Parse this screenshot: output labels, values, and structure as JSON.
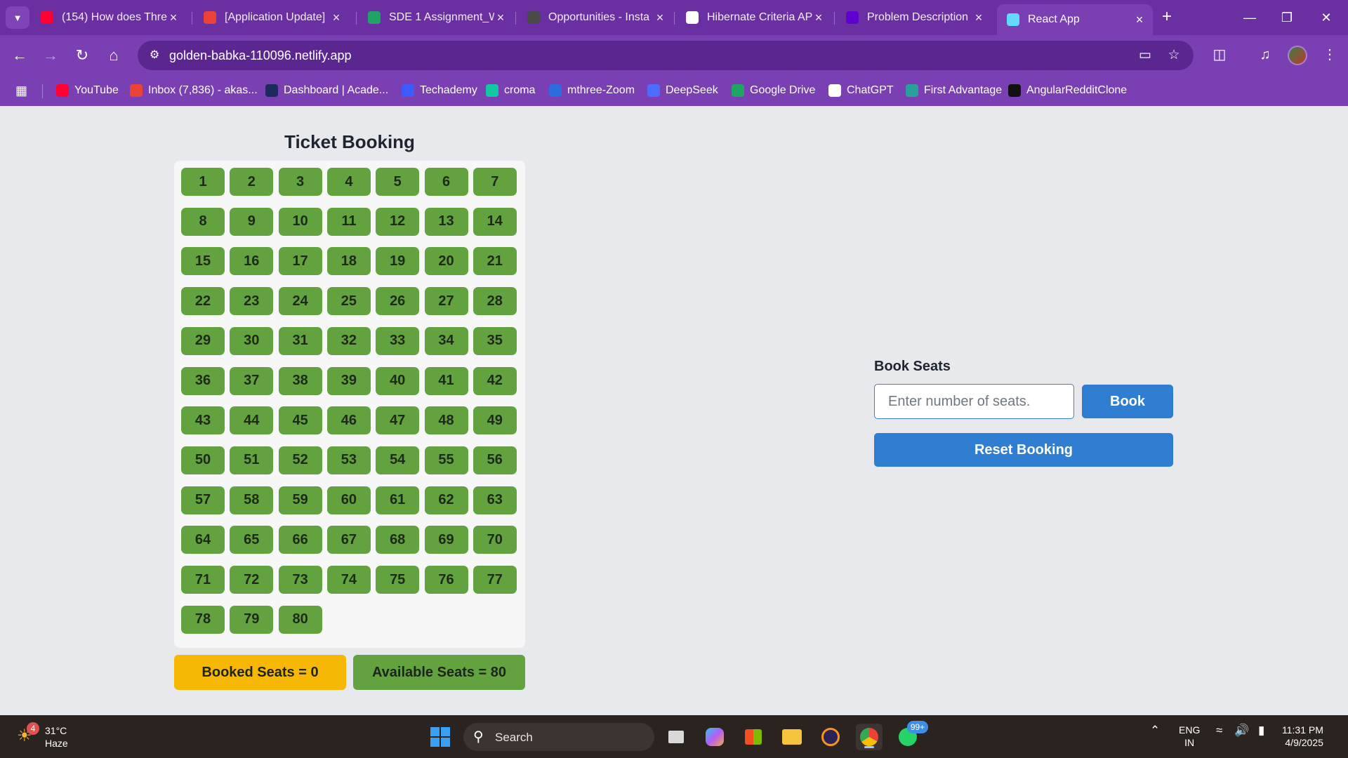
{
  "browser": {
    "tabs": [
      {
        "title": "(154) How does Thre",
        "icon": "youtube-icon",
        "color": "#ff0033",
        "active": false
      },
      {
        "title": "[Application Update]",
        "icon": "gmail-icon",
        "color": "#ea4335",
        "active": false
      },
      {
        "title": "SDE 1 Assignment_W",
        "icon": "google-drive-icon",
        "color": "#1fa463",
        "active": false
      },
      {
        "title": "Opportunities - Insta",
        "icon": "instahyre-icon",
        "color": "#4a4a4a",
        "active": false
      },
      {
        "title": "Hibernate Criteria AP",
        "icon": "chatgpt-icon",
        "color": "#ffffff",
        "active": false
      },
      {
        "title": "Problem Description",
        "icon": "yahoo-icon",
        "color": "#6001d2",
        "active": false
      },
      {
        "title": "React App",
        "icon": "react-icon",
        "color": "#61dafb",
        "active": true
      }
    ],
    "url": "golden-babka-110096.netlify.app",
    "bookmarks": [
      {
        "label": "YouTube",
        "icon": "youtube-icon",
        "color": "#ff0033"
      },
      {
        "label": "Inbox (7,836) - akas...",
        "icon": "gmail-icon",
        "color": "#ea4335"
      },
      {
        "label": "Dashboard | Acade...",
        "icon": "dashboard-icon",
        "color": "#1a2b5c"
      },
      {
        "label": "Techademy",
        "icon": "techademy-icon",
        "color": "#3d5afe"
      },
      {
        "label": "croma",
        "icon": "croma-icon",
        "color": "#12c7a3"
      },
      {
        "label": "mthree-Zoom",
        "icon": "zoom-icon",
        "color": "#2d6cdf"
      },
      {
        "label": "DeepSeek",
        "icon": "deepseek-icon",
        "color": "#4d6bfe"
      },
      {
        "label": "Google Drive",
        "icon": "google-drive-icon",
        "color": "#1fa463"
      },
      {
        "label": "ChatGPT",
        "icon": "chatgpt-icon",
        "color": "#ffffff"
      },
      {
        "label": "First Advantage",
        "icon": "first-advantage-icon",
        "color": "#2aa198"
      },
      {
        "label": "AngularRedditClone",
        "icon": "angular-icon",
        "color": "#111111"
      }
    ]
  },
  "app": {
    "title": "Ticket Booking",
    "seats": [
      "1",
      "2",
      "3",
      "4",
      "5",
      "6",
      "7",
      "8",
      "9",
      "10",
      "11",
      "12",
      "13",
      "14",
      "15",
      "16",
      "17",
      "18",
      "19",
      "20",
      "21",
      "22",
      "23",
      "24",
      "25",
      "26",
      "27",
      "28",
      "29",
      "30",
      "31",
      "32",
      "33",
      "34",
      "35",
      "36",
      "37",
      "38",
      "39",
      "40",
      "41",
      "42",
      "43",
      "44",
      "45",
      "46",
      "47",
      "48",
      "49",
      "50",
      "51",
      "52",
      "53",
      "54",
      "55",
      "56",
      "57",
      "58",
      "59",
      "60",
      "61",
      "62",
      "63",
      "64",
      "65",
      "66",
      "67",
      "68",
      "69",
      "70",
      "71",
      "72",
      "73",
      "74",
      "75",
      "76",
      "77",
      "78",
      "79",
      "80"
    ],
    "booked_label": "Booked Seats = 0",
    "available_label": "Available Seats = 80",
    "book_heading": "Book Seats",
    "input_placeholder": "Enter number of seats.",
    "input_value": "",
    "book_button": "Book",
    "reset_button": "Reset Booking",
    "colors": {
      "available_seat": "#62a33f",
      "booked_badge": "#f7b705",
      "primary": "#2f7ed1"
    }
  },
  "taskbar": {
    "weather_temp": "31°C",
    "weather_cond": "Haze",
    "weather_badge": "4",
    "search_label": "Search",
    "whatsapp_badge": "99+",
    "lang_line1": "ENG",
    "lang_line2": "IN",
    "time": "11:31 PM",
    "date": "4/9/2025"
  }
}
